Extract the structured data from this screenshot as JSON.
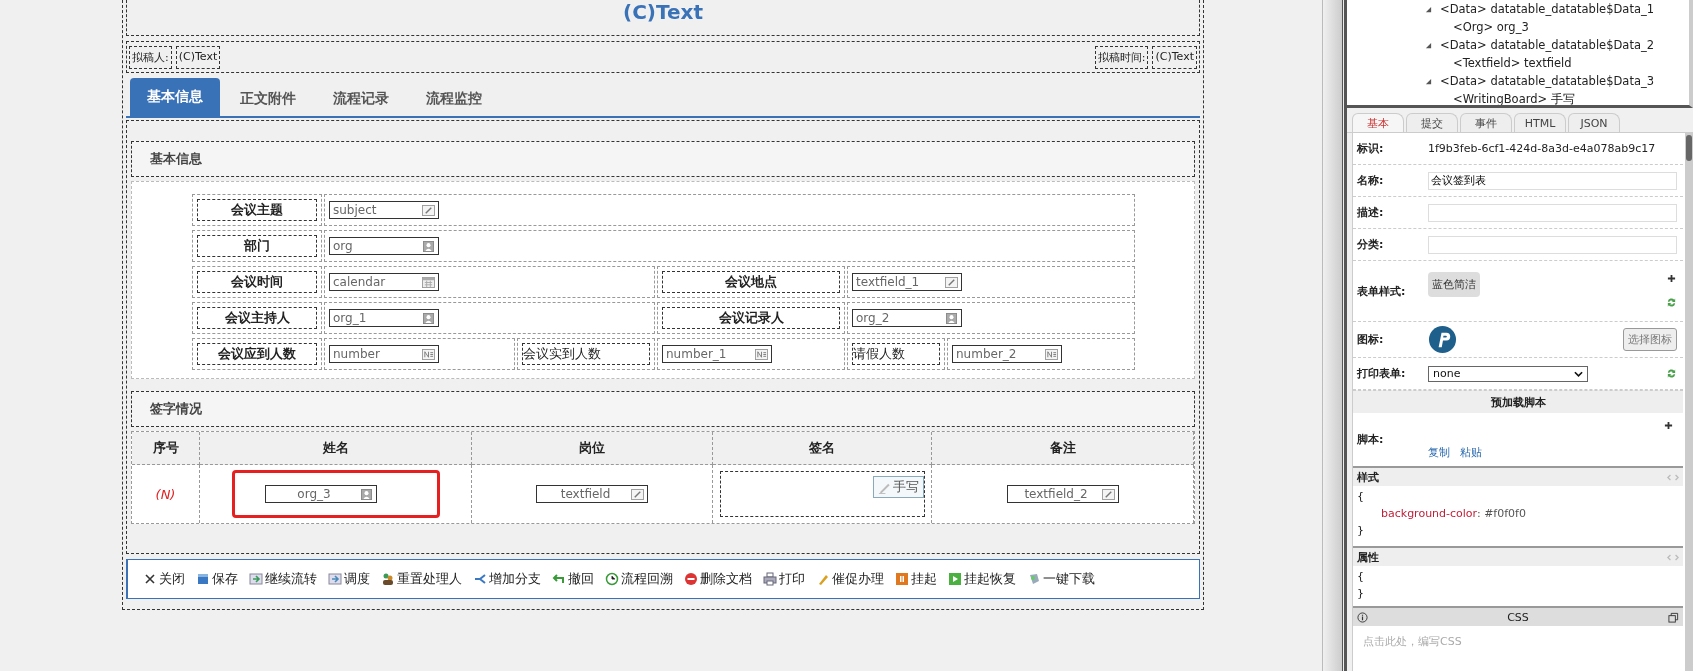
{
  "form": {
    "title": "(C)Text",
    "drafter": {
      "label": "拟稿人:",
      "value": "(C)Text"
    },
    "draft_time": {
      "label": "拟稿时间:",
      "value": "(C)Text"
    },
    "tabs": [
      {
        "label": "基本信息",
        "selected": true
      },
      {
        "label": "正文附件",
        "selected": false
      },
      {
        "label": "流程记录",
        "selected": false
      },
      {
        "label": "流程监控",
        "selected": false
      }
    ],
    "basic_section": {
      "title": "基本信息",
      "rows": [
        [
          {
            "label": "会议主题",
            "bold": true,
            "field": {
              "value": "subject",
              "kind": "text"
            }
          }
        ],
        [
          {
            "label": "部门",
            "bold": true,
            "field": {
              "value": "org",
              "kind": "org"
            }
          }
        ],
        [
          {
            "label": "会议时间",
            "bold": true,
            "field": {
              "value": "calendar",
              "kind": "date"
            }
          },
          {
            "label": "会议地点",
            "bold": true,
            "field": {
              "value": "textfield_1",
              "kind": "text"
            }
          }
        ],
        [
          {
            "label": "会议主持人",
            "bold": true,
            "field": {
              "value": "org_1",
              "kind": "org"
            }
          },
          {
            "label": "会议记录人",
            "bold": true,
            "field": {
              "value": "org_2",
              "kind": "org"
            }
          }
        ],
        [
          {
            "label": "会议应到人数",
            "bold": true,
            "field": {
              "value": "number",
              "kind": "number"
            }
          },
          {
            "label": "会议实到人数",
            "bold": false,
            "field": {
              "value": "number_1",
              "kind": "number"
            }
          },
          {
            "label": "请假人数",
            "bold": false,
            "field": {
              "value": "number_2",
              "kind": "number"
            }
          }
        ]
      ]
    },
    "sign_section": {
      "title": "签字情况",
      "columns": [
        "序号",
        "姓名",
        "岗位",
        "签名",
        "备注"
      ],
      "row": [
        {
          "kind": "index",
          "text": "(N)"
        },
        {
          "kind": "field",
          "field": {
            "value": "org_3",
            "kind": "org"
          },
          "highlighted": true
        },
        {
          "kind": "field",
          "field": {
            "value": "textfield",
            "kind": "text"
          },
          "highlighted": false
        },
        {
          "kind": "writing",
          "button": "手写"
        },
        {
          "kind": "field",
          "field": {
            "value": "textfield_2",
            "kind": "text"
          },
          "highlighted": false
        }
      ]
    },
    "toolbar": [
      {
        "label": "关闭",
        "kind": "close"
      },
      {
        "label": "保存",
        "kind": "save"
      },
      {
        "label": "继续流转",
        "kind": "forward"
      },
      {
        "label": "调度",
        "kind": "dispatch"
      },
      {
        "label": "重置处理人",
        "kind": "people"
      },
      {
        "label": "增加分支",
        "kind": "branch"
      },
      {
        "label": "撤回",
        "kind": "undo"
      },
      {
        "label": "流程回溯",
        "kind": "clock"
      },
      {
        "label": "删除文档",
        "kind": "delete"
      },
      {
        "label": "打印",
        "kind": "print"
      },
      {
        "label": "催促办理",
        "kind": "urge"
      },
      {
        "label": "挂起",
        "kind": "pause"
      },
      {
        "label": "挂起恢复",
        "kind": "play"
      },
      {
        "label": "一键下载",
        "kind": "download"
      }
    ]
  },
  "tree": [
    {
      "label": "<Data> datatable_datatable$Data_1",
      "expanded": true,
      "children": [
        {
          "label": "<Org> org_3"
        }
      ]
    },
    {
      "label": "<Data> datatable_datatable$Data_2",
      "expanded": true,
      "children": [
        {
          "label": "<Textfield> textfield"
        }
      ]
    },
    {
      "label": "<Data> datatable_datatable$Data_3",
      "expanded": true,
      "children": [
        {
          "label": "<WritingBoard> 手写"
        }
      ]
    }
  ],
  "prop_tabs": [
    {
      "label": "基本",
      "selected": true
    },
    {
      "label": "提交",
      "selected": false
    },
    {
      "label": "事件",
      "selected": false
    },
    {
      "label": "HTML",
      "selected": false
    },
    {
      "label": "JSON",
      "selected": false
    }
  ],
  "props": [
    {
      "kind": "text",
      "label": "标识:",
      "value": "1f9b3feb-6cf1-424d-8a3d-e4a078ab9c17"
    },
    {
      "kind": "input",
      "label": "名称:",
      "value": "会议签到表"
    },
    {
      "kind": "input",
      "label": "描述:"
    },
    {
      "kind": "input",
      "label": "分类:"
    },
    {
      "kind": "style",
      "label": "表单样式:",
      "button": "蓝色简洁"
    },
    {
      "kind": "icon",
      "label": "图标:",
      "button": "选择图标"
    },
    {
      "kind": "select",
      "label": "打印表单:",
      "value": "none"
    }
  ],
  "preload": {
    "title": "预加载脚本",
    "label": "脚本:",
    "links": [
      "复制",
      "粘贴"
    ]
  },
  "style_panel": {
    "title": "样式",
    "lines": [
      {
        "text": "{"
      },
      {
        "property": "background-color",
        "separator": ":",
        "value": "#f0f0f0"
      },
      {
        "text": "}"
      }
    ]
  },
  "attr_panel": {
    "title": "属性",
    "lines": [
      {
        "text": "{"
      },
      {
        "text": "}"
      }
    ]
  },
  "css_panel": {
    "title": "CSS",
    "placeholder": "点击此处，编写CSS"
  }
}
